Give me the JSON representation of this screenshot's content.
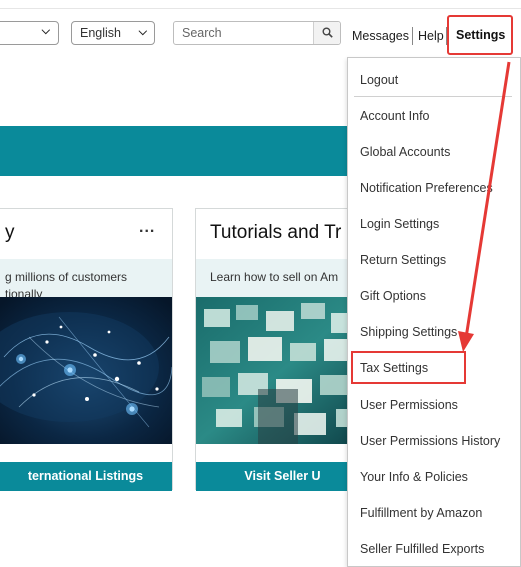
{
  "header": {
    "language_select": {
      "value": "English"
    },
    "search": {
      "placeholder": "Search"
    },
    "links": {
      "messages": "Messages",
      "help": "Help",
      "settings": "Settings"
    }
  },
  "cards": [
    {
      "title": "y",
      "menu": "...",
      "description": "g millions of customers\ntionally",
      "action": "ternational Listings"
    },
    {
      "title": "Tutorials and Tr",
      "description": "Learn how to sell on Am",
      "action": "Visit Seller U"
    }
  ],
  "settings_menu": {
    "items": [
      "Logout",
      "Account Info",
      "Global Accounts",
      "Notification Preferences",
      "Login Settings",
      "Return Settings",
      "Gift Options",
      "Shipping Settings",
      "Tax Settings",
      "User Permissions",
      "User Permissions History",
      "Your Info & Policies",
      "Fulfillment by Amazon",
      "Seller Fulfilled Exports"
    ],
    "highlighted_item": "Tax Settings"
  },
  "colors": {
    "teal": "#0a8a9a",
    "annotation_red": "#e53935"
  }
}
